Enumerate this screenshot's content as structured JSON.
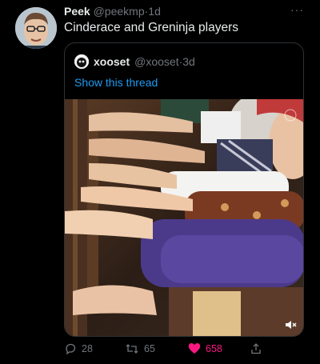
{
  "tweet": {
    "author_name": "Peek",
    "author_handle": "@peekmp",
    "separator": "·",
    "time": "1d",
    "more": "···",
    "text": "Cinderace and Greninja players"
  },
  "quoted": {
    "author_name": "xooset",
    "author_handle": "@xooset",
    "separator": "·",
    "time": "3d",
    "link_text": "Show this thread"
  },
  "actions": {
    "replies": "28",
    "retweets": "65",
    "likes": "658"
  },
  "colors": {
    "background": "#000000",
    "link": "#1d9bf0",
    "like": "#f91880",
    "muted": "#71767b"
  },
  "icons": {
    "reply": "reply-icon",
    "retweet": "retweet-icon",
    "like": "heart-icon",
    "share": "share-icon",
    "volume": "volume-muted-icon",
    "more": "more-icon"
  }
}
